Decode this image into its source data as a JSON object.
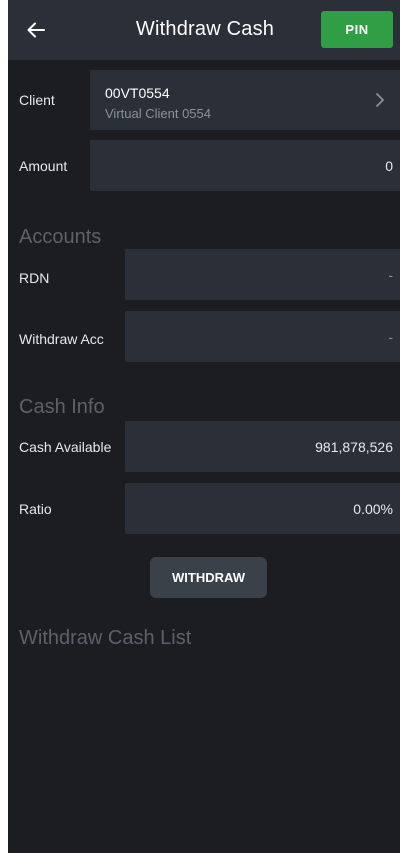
{
  "header": {
    "title": "Withdraw Cash",
    "pin_label": "PIN"
  },
  "client": {
    "label": "Client",
    "code": "00VT0554",
    "name": "Virtual Client 0554"
  },
  "amount": {
    "label": "Amount",
    "value": "0"
  },
  "accounts": {
    "section_title": "Accounts",
    "rdn_label": "RDN",
    "rdn_value": "-",
    "withdraw_acc_label": "Withdraw Acc",
    "withdraw_acc_value": "-"
  },
  "cash_info": {
    "section_title": "Cash Info",
    "cash_available_label": "Cash Available",
    "cash_available_value": "981,878,526",
    "ratio_label": "Ratio",
    "ratio_value": "0.00%"
  },
  "withdraw_button_label": "WITHDRAW",
  "list": {
    "section_title": "Withdraw Cash List"
  },
  "colors": {
    "background": "#1b1d21",
    "header": "#2b3038",
    "field": "#2b3038",
    "pin": "#2f9e44",
    "section_title": "#5c6169"
  },
  "icons": {
    "back": "arrow-left-icon",
    "chevron": "chevron-right-icon"
  }
}
